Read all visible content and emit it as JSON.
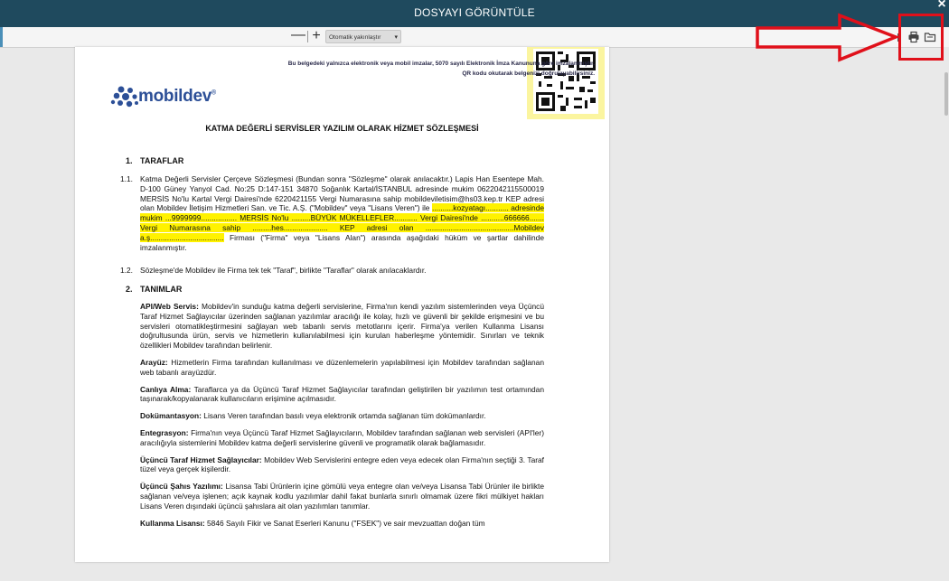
{
  "window": {
    "title": "DOSYAYI GÖRÜNTÜLE",
    "close_glyph": "×"
  },
  "toolbar": {
    "zoom_out": "—",
    "zoom_in": "+",
    "zoom_select_value": "Otomatik yakınlaştır",
    "icons": [
      "presentation-icon",
      "print-icon",
      "open-file-icon"
    ]
  },
  "annotation": {
    "arrow_color": "#e0101a"
  },
  "document": {
    "signature_note_line1": "Bu belgedeki yalnızca elektronik veya mobil imzalar, 5070 sayılı Elektronik İmza Kanununa göre imzalanmıştır.",
    "signature_note_line2": "QR kodu okutarak belgenizi doğrulayabilirsiniz.",
    "logo_text": "mobildev",
    "logo_mark": "®",
    "title": "KATMA DEĞERLİ SERVİSLER YAZILIM OLARAK HİZMET SÖZLEŞMESİ",
    "sections": {
      "s1_number": "1.",
      "s1_title": "TARAFLAR",
      "p11_number": "1.1.",
      "p11_text": "Katma Değerli Servisler Çerçeve Sözleşmesi (Bundan sonra \"Sözleşme\" olarak anılacaktır.) Lapis Han Esentepe Mah. D-100 Güney Yanyol Cad. No:25 D:147-151 34870 Soğanlık Kartal/İSTANBUL adresinde mukim 0622042115500019 MERSİS No'lu Kartal Vergi Dairesi'nde 6220421155 Vergi Numarasına sahip mobildeviletisim@hs03.kep.tr KEP adresi olan Mobildev İletişim Hizmetleri San. ve Tic. A.Ş. (\"Mobildev\" veya \"Lisans Veren\") ile",
      "p11_highlight": "..........kozyatagı........... adresinde mukim ...9999999................. MERSİS No'lu .........BÜYÜK MÜKELLEFLER........... Vergi Dairesi'nde ...........666666....... Vergi Numarasına sahip .........hes..................... KEP adresi olan ..........................................Mobildev a.ş...................................",
      "p11_tail": " Firması (\"Firma\" veya \"Lisans Alan\") arasında aşağıdaki hüküm ve şartlar dahilinde imzalanmıştır.",
      "p12_number": "1.2.",
      "p12_text": "Sözleşme'de Mobildev ile Firma  tek tek \"Taraf\", birlikte \"Taraflar\" olarak anılacaklardır.",
      "s2_number": "2.",
      "s2_title": "TANIMLAR"
    },
    "definitions": [
      {
        "term": "API/Web Servis:",
        "text": " Mobildev'in sunduğu katma değerli servislerine, Firma'nın kendi yazılım sistemlerinden veya Üçüncü Taraf Hizmet Sağlayıcılar üzerinden sağlanan yazılımlar aracılığı ile kolay, hızlı ve güvenli bir şekilde erişmesini ve bu servisleri otomatikleştirmesini sağlayan web tabanlı servis metotlarını içerir. Firma'ya verilen Kullanma Lisansı doğrultusunda ürün, servis ve hizmetlerin kullanılabilmesi için kurulan haberleşme yöntemidir. Sınırları ve teknik özellikleri Mobildev tarafından belirlenir."
      },
      {
        "term": "Arayüz:",
        "text": " Hizmetlerin Firma tarafından kullanılması ve düzenlemelerin yapılabilmesi için Mobildev tarafından sağlanan web tabanlı arayüzdür."
      },
      {
        "term": "Canlıya Alma:",
        "text": " Taraflarca ya da Üçüncü Taraf Hizmet Sağlayıcılar tarafından geliştirilen bir yazılımın test ortamından taşınarak/kopyalanarak kullanıcıların erişimine açılmasıdır."
      },
      {
        "term": "Dokümantasyon:",
        "text": " Lisans Veren tarafından basılı veya elektronik ortamda sağlanan tüm dokümanlardır."
      },
      {
        "term": "Entegrasyon:",
        "text": " Firma'nın veya Üçüncü Taraf Hizmet Sağlayıcıların, Mobildev tarafından sağlanan web servisleri (API'ler) aracılığıyla sistemlerini Mobildev katma değerli servislerine güvenli ve programatik olarak bağlamasıdır."
      },
      {
        "term": "Üçüncü Taraf Hizmet Sağlayıcılar:",
        "text": " Mobildev Web Servislerini entegre eden veya edecek olan Firma'nın seçtiği 3. Taraf tüzel veya gerçek kişilerdir."
      },
      {
        "term": "Üçüncü Şahıs Yazılımı:",
        "text": " Lisansa Tabi Ürünlerin içine gömülü veya entegre olan ve/veya Lisansa Tabi Ürünler ile birlikte sağlanan ve/veya işlenen; açık kaynak kodlu yazılımlar dahil fakat bunlarla sınırlı olmamak üzere fikri mülkiyet hakları Lisans Veren dışındaki üçüncü şahıslara ait olan yazılımları tanımlar."
      },
      {
        "term": "Kullanma Lisansı:",
        "text": " 5846 Sayılı Fikir ve Sanat Eserleri Kanunu (\"FSEK\") ve sair mevzuattan doğan tüm"
      }
    ]
  }
}
